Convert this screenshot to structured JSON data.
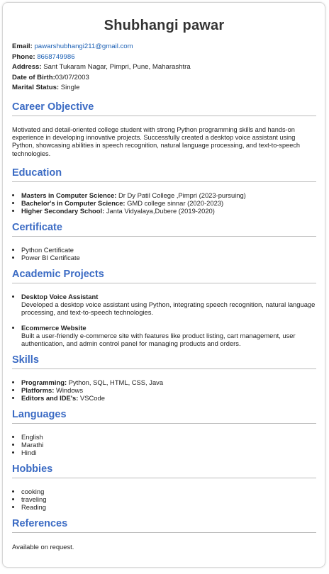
{
  "name": "Shubhangi pawar",
  "contact": {
    "email_label": "Email:",
    "email": "pawarshubhangi211@gmail.com",
    "phone_label": "Phone:",
    "phone": "8668749986",
    "address_label": "Address:",
    "address": "Sant Tukaram Nagar, Pimpri, Pune, Maharashtra",
    "dob_label": "Date of Birth:",
    "dob": "03/07/2003",
    "marital_label": "Marital Status:",
    "marital": "Single"
  },
  "career": {
    "title": "Career Objective",
    "text": "Motivated and detail-oriented college student with strong Python programming skills and hands-on experience in developing innovative projects. Successfully created a desktop voice assistant using Python, showcasing abilities in speech recognition, natural language processing, and text-to-speech technologies."
  },
  "education": {
    "title": "Education",
    "items": [
      {
        "label": "Masters in Computer Science:",
        "value": "Dr Dy Patil College ,Pimpri (2023-pursuing)"
      },
      {
        "label": "Bachelor's in Computer Science:",
        "value": "GMD college sinnar (2020-2023)"
      },
      {
        "label": "Higher Secondary School:",
        "value": "Janta Vidyalaya,Dubere (2019-2020)"
      }
    ]
  },
  "certificate": {
    "title": "Certificate",
    "items": [
      "Python Certificate",
      "Power BI Certificate"
    ]
  },
  "projects": {
    "title": "Academic Projects",
    "items": [
      {
        "name": "Desktop Voice Assistant",
        "desc": "Developed a desktop voice assistant using Python, integrating speech recognition, natural language processing, and text-to-speech technologies."
      },
      {
        "name": "Ecommerce Website",
        "desc": "Built a user-friendly e-commerce site with features like product listing, cart management, user authentication, and admin control panel for managing products and orders."
      }
    ]
  },
  "skills": {
    "title": "Skills",
    "items": [
      {
        "label": "Programming:",
        "value": "Python, SQL, HTML, CSS, Java"
      },
      {
        "label": "Platforms:",
        "value": "Windows"
      },
      {
        "label": "Editors and IDE's:",
        "value": "VSCode"
      }
    ]
  },
  "languages": {
    "title": "Languages",
    "items": [
      "English",
      "Marathi",
      "Hindi"
    ]
  },
  "hobbies": {
    "title": "Hobbies",
    "items": [
      "cooking",
      "traveling",
      "Reading"
    ]
  },
  "references": {
    "title": "References",
    "text": "Available on request."
  }
}
